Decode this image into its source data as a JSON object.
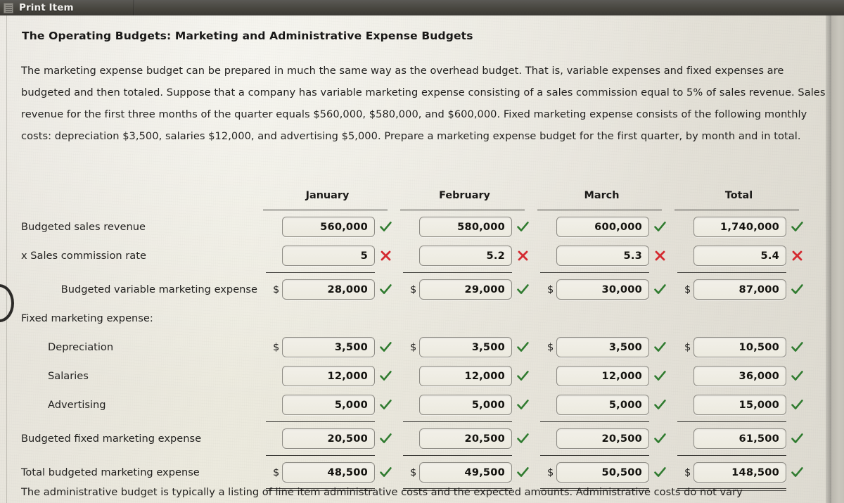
{
  "topbar": {
    "icon": "list-document-icon",
    "title": "Print Item"
  },
  "document": {
    "title": "The Operating Budgets: Marketing and Administrative Expense Budgets",
    "paragraph": "The marketing expense budget can be prepared in much the same way as the overhead budget. That is, variable expenses and fixed expenses are budgeted and then totaled. Suppose that a company has variable marketing expense consisting of a sales commission equal to 5% of sales revenue. Sales revenue for the first three months of the quarter equals $560,000, $580,000, and $600,000. Fixed marketing expense consists of the following monthly costs: depreciation $3,500, salaries $12,000, and advertising $5,000. Prepare a marketing expense budget for the first quarter, by month and in total.",
    "footer_paragraph": "The administrative budget is typically a listing of line item administrative costs and the expected amounts. Administrative costs do not vary"
  },
  "colors": {
    "correct": "#2f7b2f",
    "incorrect": "#d42a30",
    "paper": "#eceade",
    "topbar": "#48463f"
  },
  "table": {
    "columns": [
      "January",
      "February",
      "March",
      "Total"
    ],
    "label_header": "",
    "rows": [
      {
        "label": "Budgeted sales revenue",
        "indent": false,
        "dollar": [
          false,
          false,
          false,
          false
        ],
        "values": [
          "560,000",
          "580,000",
          "600,000",
          "1,740,000"
        ],
        "marks": [
          "check",
          "check",
          "check",
          "check"
        ]
      },
      {
        "label": "x Sales commission rate",
        "indent": false,
        "dollar": [
          false,
          false,
          false,
          false
        ],
        "values": [
          "5",
          "5.2",
          "5.3",
          "5.4"
        ],
        "marks": [
          "cross",
          "cross",
          "cross",
          "cross"
        ]
      },
      {
        "label": "Budgeted variable marketing expense",
        "indent": false,
        "dollar": [
          true,
          true,
          true,
          true
        ],
        "values": [
          "28,000",
          "29,000",
          "30,000",
          "87,000"
        ],
        "marks": [
          "check",
          "check",
          "check",
          "check"
        ]
      },
      {
        "label": "Fixed marketing expense:",
        "indent": false,
        "spacer": true,
        "dollar": [
          false,
          false,
          false,
          false
        ],
        "values": [
          "",
          "",
          "",
          ""
        ],
        "marks": [
          "",
          "",
          "",
          ""
        ]
      },
      {
        "label": "Depreciation",
        "indent": true,
        "dollar": [
          true,
          true,
          true,
          true
        ],
        "values": [
          "3,500",
          "3,500",
          "3,500",
          "10,500"
        ],
        "marks": [
          "check",
          "check",
          "check",
          "check"
        ]
      },
      {
        "label": "Salaries",
        "indent": true,
        "dollar": [
          false,
          false,
          false,
          false
        ],
        "values": [
          "12,000",
          "12,000",
          "12,000",
          "36,000"
        ],
        "marks": [
          "check",
          "check",
          "check",
          "check"
        ]
      },
      {
        "label": "Advertising",
        "indent": true,
        "dollar": [
          false,
          false,
          false,
          false
        ],
        "values": [
          "5,000",
          "5,000",
          "5,000",
          "15,000"
        ],
        "marks": [
          "check",
          "check",
          "check",
          "check"
        ]
      },
      {
        "label": "Budgeted fixed marketing expense",
        "indent": false,
        "dollar": [
          false,
          false,
          false,
          false
        ],
        "values": [
          "20,500",
          "20,500",
          "20,500",
          "61,500"
        ],
        "marks": [
          "check",
          "check",
          "check",
          "check"
        ]
      },
      {
        "label": "Total budgeted marketing expense",
        "indent": false,
        "dollar": [
          true,
          true,
          true,
          true
        ],
        "values": [
          "48,500",
          "49,500",
          "50,500",
          "148,500"
        ],
        "marks": [
          "check",
          "check",
          "check",
          "check"
        ]
      }
    ]
  }
}
